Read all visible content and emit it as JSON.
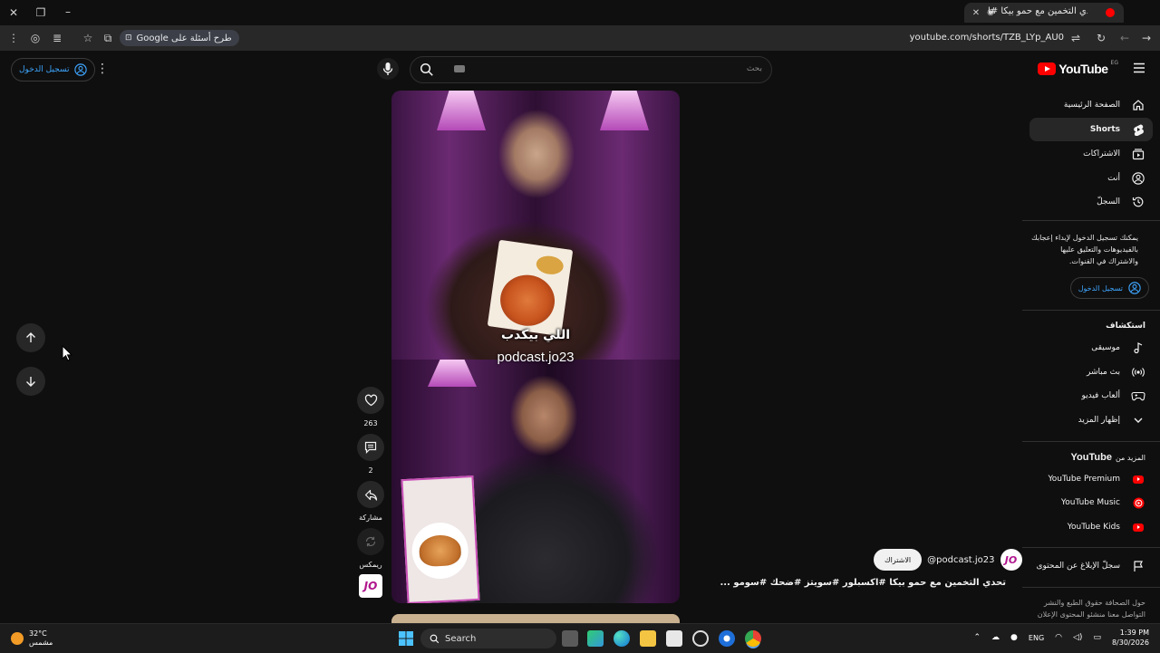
{
  "browser": {
    "tab_title": "تحدي التخمين مع حمو بيكا #ا",
    "url": "youtube.com/shorts/TZB_LYp_AU0",
    "ask_google_label": "طرح أسئلة على Google"
  },
  "header": {
    "logo_word": "YouTube",
    "logo_region": "EG",
    "search_placeholder": "بحث",
    "sign_in_label": "تسجيل الدخول"
  },
  "sidebar": {
    "items": [
      {
        "label": "الصفحة الرئيسية",
        "icon": "home-icon"
      },
      {
        "label": "Shorts",
        "icon": "shorts-icon",
        "active": true
      },
      {
        "label": "الاشتراكات",
        "icon": "subscriptions-icon"
      },
      {
        "label": "أنت",
        "icon": "you-icon"
      },
      {
        "label": "السجلّ",
        "icon": "history-icon"
      }
    ],
    "signin_note": "يمكنك تسجيل الدخول لإبداء إعجابك بالفيديوهات والتعليق عليها والاشتراك في القنوات.",
    "signin_button": "تسجيل الدخول",
    "explore_title": "استكشاف",
    "explore_items": [
      {
        "label": "موسيقى",
        "icon": "music-icon"
      },
      {
        "label": "بث مباشر",
        "icon": "live-icon"
      },
      {
        "label": "ألعاب فيديو",
        "icon": "gaming-icon"
      },
      {
        "label": "إظهار المزيد",
        "icon": "chevron-down-icon"
      }
    ],
    "more_title_prefix": "المزيد من",
    "more_title_brand": "YouTube",
    "more_items": [
      {
        "label": "YouTube Premium",
        "icon": "youtube-premium-icon"
      },
      {
        "label": "YouTube Music",
        "icon": "youtube-music-icon"
      },
      {
        "label": "YouTube Kids",
        "icon": "youtube-kids-icon"
      }
    ],
    "report_label": "سجلّ الإبلاغ عن المحتوى",
    "footer_links": "حول  الصحافة  حقوق الطبع والنشر  التواصل معنا  منشئو المحتوى  الإعلان"
  },
  "short": {
    "caption": "اللي بيكدب",
    "watermark": "podcast.jo23",
    "like_count": "263",
    "comment_count": "2",
    "share_label": "مشاركة",
    "remix_label": "ريمكس",
    "channel_handle": "@podcast.jo23",
    "subscribe_label": "الاشتراك",
    "title": "تحدي التخمين مع حمو بيكا #اكسبلور #سويتز #ضحك #سومو ...",
    "channel_logo_text": "JO"
  },
  "taskbar": {
    "weather_temp": "32°C",
    "weather_desc": "مشمس",
    "search_label": "Search",
    "lang": "ENG",
    "time": "1:39 PM",
    "date": "8/30/2026"
  },
  "colors": {
    "background": "#0f0f0f",
    "accent_link": "#3ea6ff",
    "brand_red": "#ff0000"
  }
}
